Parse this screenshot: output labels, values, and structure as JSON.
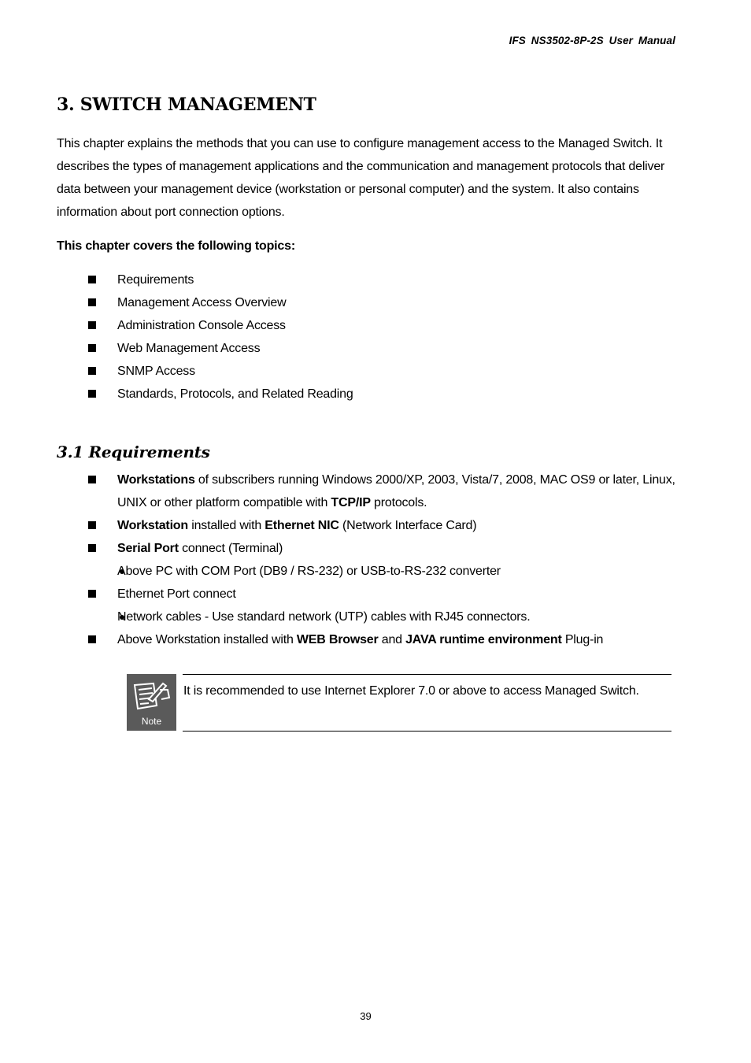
{
  "header": {
    "title": "IFS  NS3502-8P-2S  User  Manual"
  },
  "chapter": {
    "title": "3. SWITCH MANAGEMENT",
    "intro": "This chapter explains the methods that you can use to configure management access to the Managed Switch. It describes the types of management applications and the communication and management protocols that deliver data between your management device (workstation or personal computer) and the system. It also contains information about port connection options.",
    "topics_label": "This chapter covers the following topics:",
    "topics": [
      "Requirements",
      "Management Access Overview",
      "Administration Console Access",
      "Web Management Access",
      "SNMP Access",
      "Standards, Protocols, and Related Reading"
    ]
  },
  "section": {
    "title": "3.1 Requirements",
    "items": [
      {
        "bold1": "Workstations",
        "text1": " of subscribers running Windows 2000/XP, 2003, Vista/7, 2008, MAC OS9 or later, Linux, UNIX or other platform compatible with ",
        "bold2": "TCP/IP",
        "text2": " protocols."
      },
      {
        "bold1": "Workstation",
        "text1": " installed with ",
        "bold2": "Ethernet NIC",
        "text2": " (Network Interface Card)"
      },
      {
        "bold1": "Serial Port",
        "text1": " connect (Terminal)",
        "sub": "Above PC with COM Port (DB9 / RS-232) or USB-to-RS-232 converter"
      },
      {
        "text1": "Ethernet Port connect",
        "sub": "Network cables - Use standard network (UTP) cables with RJ45 connectors."
      },
      {
        "text1": "Above Workstation installed with ",
        "bold1": "WEB Browser",
        "text2": " and ",
        "bold2": "JAVA runtime environment",
        "text3": " Plug-in"
      }
    ]
  },
  "note": {
    "icon_label": "Note",
    "text": "It is recommended to use Internet Explorer 7.0 or above to access Managed Switch."
  },
  "footer": {
    "page_number": "39"
  }
}
